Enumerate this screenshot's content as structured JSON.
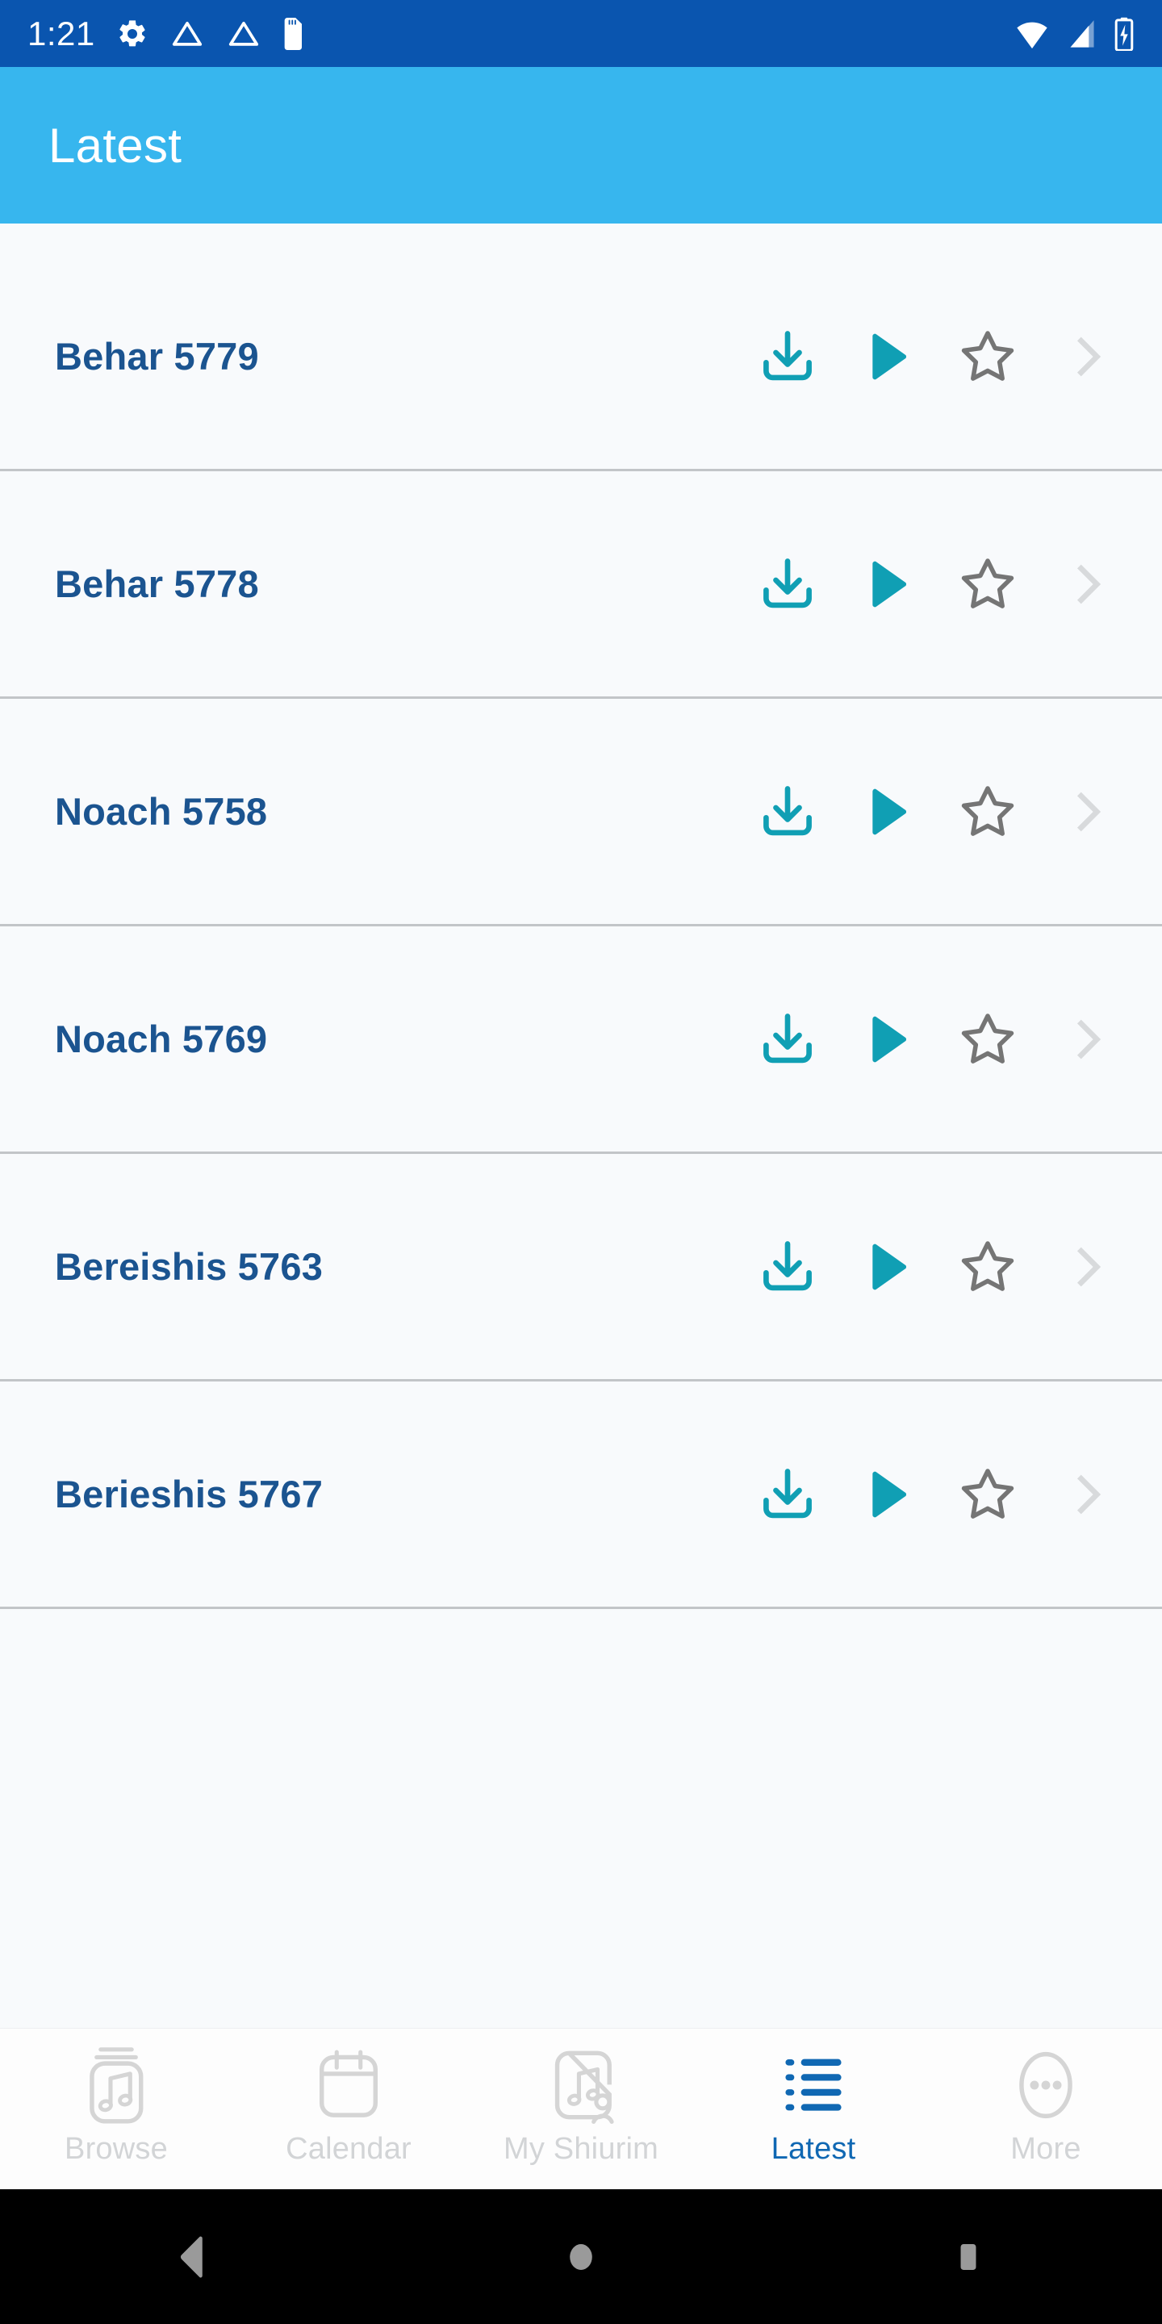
{
  "status_bar": {
    "time": "1:21",
    "left_icons": [
      "settings-gear-icon",
      "cloud-icon",
      "cloud-icon",
      "sd-card-icon"
    ],
    "right_icons": [
      "wifi-icon",
      "cellular-signal-icon",
      "battery-charging-icon"
    ],
    "background_color": "#0A55AF"
  },
  "app_bar": {
    "title": "Latest",
    "background_color": "#37B6EE",
    "title_color": "#FFFFFF"
  },
  "colors": {
    "accent_teal": "#109FB4",
    "title_blue": "#1B5490",
    "star_gray": "#757575",
    "chevron_gray": "#D8DADC",
    "nav_inactive": "#D2D4D6",
    "nav_active": "#1068B3",
    "divider": "#C2C5C8",
    "content_background": "#F8FAFC"
  },
  "list": {
    "items": [
      {
        "title": "Behar 5779",
        "download_icon": "download-icon",
        "play_icon": "play-icon",
        "favorite_icon": "star-outline-icon",
        "chevron_icon": "chevron-right-icon"
      },
      {
        "title": "Behar 5778",
        "download_icon": "download-icon",
        "play_icon": "play-icon",
        "favorite_icon": "star-outline-icon",
        "chevron_icon": "chevron-right-icon"
      },
      {
        "title": "Noach 5758",
        "download_icon": "download-icon",
        "play_icon": "play-icon",
        "favorite_icon": "star-outline-icon",
        "chevron_icon": "chevron-right-icon"
      },
      {
        "title": "Noach 5769",
        "download_icon": "download-icon",
        "play_icon": "play-icon",
        "favorite_icon": "star-outline-icon",
        "chevron_icon": "chevron-right-icon"
      },
      {
        "title": "Bereishis 5763",
        "download_icon": "download-icon",
        "play_icon": "play-icon",
        "favorite_icon": "star-outline-icon",
        "chevron_icon": "chevron-right-icon"
      },
      {
        "title": "Berieshis 5767",
        "download_icon": "download-icon",
        "play_icon": "play-icon",
        "favorite_icon": "star-outline-icon",
        "chevron_icon": "chevron-right-icon"
      }
    ]
  },
  "bottom_nav": {
    "items": [
      {
        "label": "Browse",
        "icon": "music-library-icon",
        "active": false
      },
      {
        "label": "Calendar",
        "icon": "calendar-icon",
        "active": false
      },
      {
        "label": "My Shiurim",
        "icon": "my-music-person-icon",
        "active": false
      },
      {
        "label": "Latest",
        "icon": "list-bullet-icon",
        "active": true
      },
      {
        "label": "More",
        "icon": "more-ellipsis-icon",
        "active": false
      }
    ]
  },
  "android_nav": {
    "buttons": [
      "back-triangle-icon",
      "home-circle-icon",
      "recents-square-icon"
    ]
  }
}
